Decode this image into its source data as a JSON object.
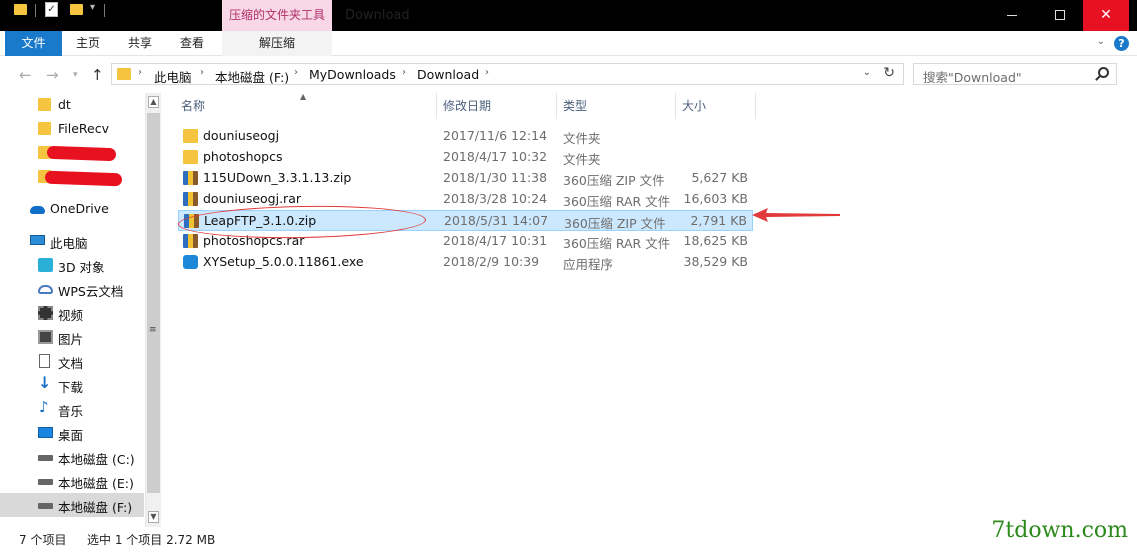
{
  "titlebar": {
    "context_tab": "压缩的文件夹工具",
    "window_title": "Download"
  },
  "ribbon": {
    "tabs": [
      "文件",
      "主页",
      "共享",
      "查看",
      "解压缩"
    ]
  },
  "address": {
    "crumbs": [
      "此电脑",
      "本地磁盘 (F:)",
      "MyDownloads",
      "Download"
    ],
    "search_placeholder": "搜索\"Download\""
  },
  "nav": {
    "items": [
      {
        "label": "dt",
        "icon": "folder-icon"
      },
      {
        "label": "FileRecv",
        "icon": "folder-icon"
      },
      {
        "label": "",
        "icon": "folder-icon",
        "redacted": true
      },
      {
        "label": "",
        "icon": "folder-icon",
        "redacted": true
      },
      {
        "label": "OneDrive",
        "icon": "onedrive-icon"
      },
      {
        "label": "此电脑",
        "icon": "pc-icon"
      },
      {
        "label": "3D 对象",
        "icon": "3d-objects-icon"
      },
      {
        "label": "WPS云文档",
        "icon": "wps-cloud-icon"
      },
      {
        "label": "视频",
        "icon": "video-icon"
      },
      {
        "label": "图片",
        "icon": "pictures-icon"
      },
      {
        "label": "文档",
        "icon": "documents-icon"
      },
      {
        "label": "下载",
        "icon": "download-icon"
      },
      {
        "label": "音乐",
        "icon": "music-icon"
      },
      {
        "label": "桌面",
        "icon": "desktop-icon"
      },
      {
        "label": "本地磁盘 (C:)",
        "icon": "drive-icon"
      },
      {
        "label": "本地磁盘 (E:)",
        "icon": "drive-icon"
      },
      {
        "label": "本地磁盘 (F:)",
        "icon": "drive-icon",
        "selected": true
      }
    ]
  },
  "columns": [
    "名称",
    "修改日期",
    "类型",
    "大小"
  ],
  "files": [
    {
      "name": "douniuseogj",
      "date": "2017/11/6 12:14",
      "type": "文件夹",
      "size": "",
      "icon": "folder-icon"
    },
    {
      "name": "photoshopcs",
      "date": "2018/4/17 10:32",
      "type": "文件夹",
      "size": "",
      "icon": "folder-icon"
    },
    {
      "name": "115UDown_3.3.1.13.zip",
      "date": "2018/1/30 11:38",
      "type": "360压缩 ZIP 文件",
      "size": "5,627 KB",
      "icon": "archive-icon"
    },
    {
      "name": "douniuseogj.rar",
      "date": "2018/3/28 10:24",
      "type": "360压缩 RAR 文件",
      "size": "16,603 KB",
      "icon": "archive-icon"
    },
    {
      "name": "LeapFTP_3.1.0.zip",
      "date": "2018/5/31 14:07",
      "type": "360压缩 ZIP 文件",
      "size": "2,791 KB",
      "icon": "archive-icon",
      "selected": true
    },
    {
      "name": "photoshopcs.rar",
      "date": "2018/4/17 10:31",
      "type": "360压缩 RAR 文件",
      "size": "18,625 KB",
      "icon": "archive-icon"
    },
    {
      "name": "XYSetup_5.0.0.11861.exe",
      "date": "2018/2/9 10:39",
      "type": "应用程序",
      "size": "38,529 KB",
      "icon": "exe-icon"
    }
  ],
  "status": {
    "count": "7 个项目",
    "selection": "选中 1 个项目  2.72 MB"
  },
  "watermark": "7tdown.com",
  "colors": {
    "accent": "#1979ca",
    "selection": "#cce8ff",
    "context_tab": "#f8d7e6",
    "annotation": "#e23a3a",
    "close": "#e81123"
  }
}
